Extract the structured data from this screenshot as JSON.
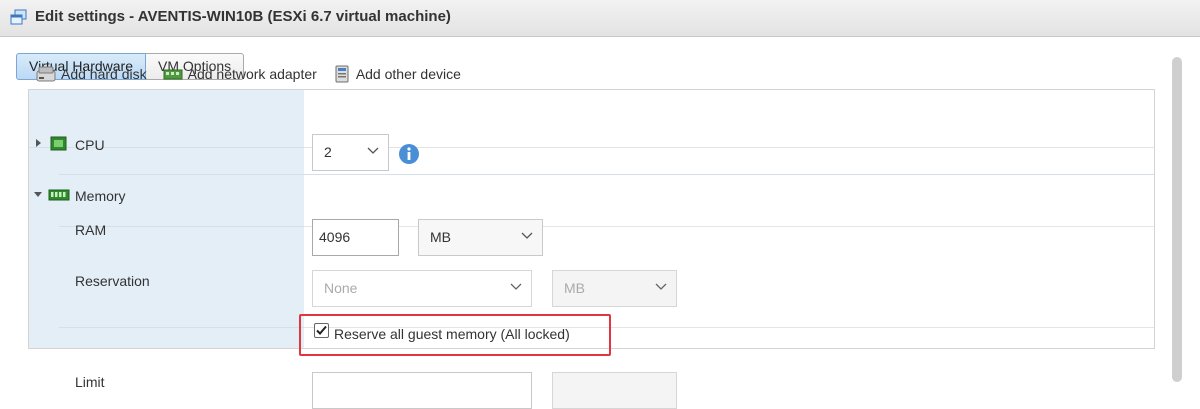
{
  "window": {
    "title": "Edit settings - AVENTIS-WIN10B (ESXi 6.7 virtual machine)"
  },
  "tabs": [
    {
      "label": "Virtual Hardware"
    },
    {
      "label": "VM Options"
    }
  ],
  "toolbar": {
    "add_hard_disk": "Add hard disk",
    "add_network_adapter": "Add network adapter",
    "add_other_device": "Add other device"
  },
  "cpu": {
    "label": "CPU",
    "value": "2"
  },
  "memory": {
    "label": "Memory",
    "ram_label": "RAM",
    "ram_value": "4096",
    "ram_unit": "MB",
    "reservation_label": "Reservation",
    "reservation_value": "None",
    "reservation_unit": "MB",
    "reserve_all_label": "Reserve all guest memory (All locked)",
    "reserve_all_checked": true,
    "limit_label": "Limit"
  },
  "colors": {
    "highlight": "#e0363d",
    "tab_active": "#bcd9f4",
    "left_column": "#e4eef7"
  }
}
